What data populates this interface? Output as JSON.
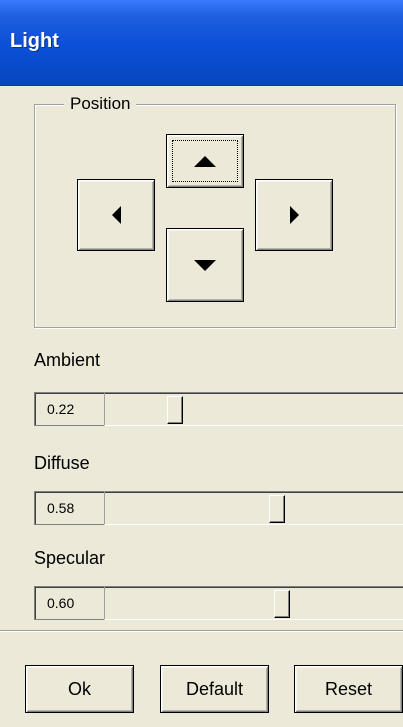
{
  "window": {
    "title": "Light"
  },
  "position": {
    "label": "Position",
    "buttons": [
      "up",
      "left",
      "right",
      "down"
    ]
  },
  "sliders": [
    {
      "label": "Ambient",
      "value": "0.22",
      "fraction": 0.22
    },
    {
      "label": "Diffuse",
      "value": "0.58",
      "fraction": 0.58
    },
    {
      "label": "Specular",
      "value": "0.60",
      "fraction": 0.6
    }
  ],
  "buttons": {
    "ok": "Ok",
    "default": "Default",
    "reset": "Reset"
  }
}
